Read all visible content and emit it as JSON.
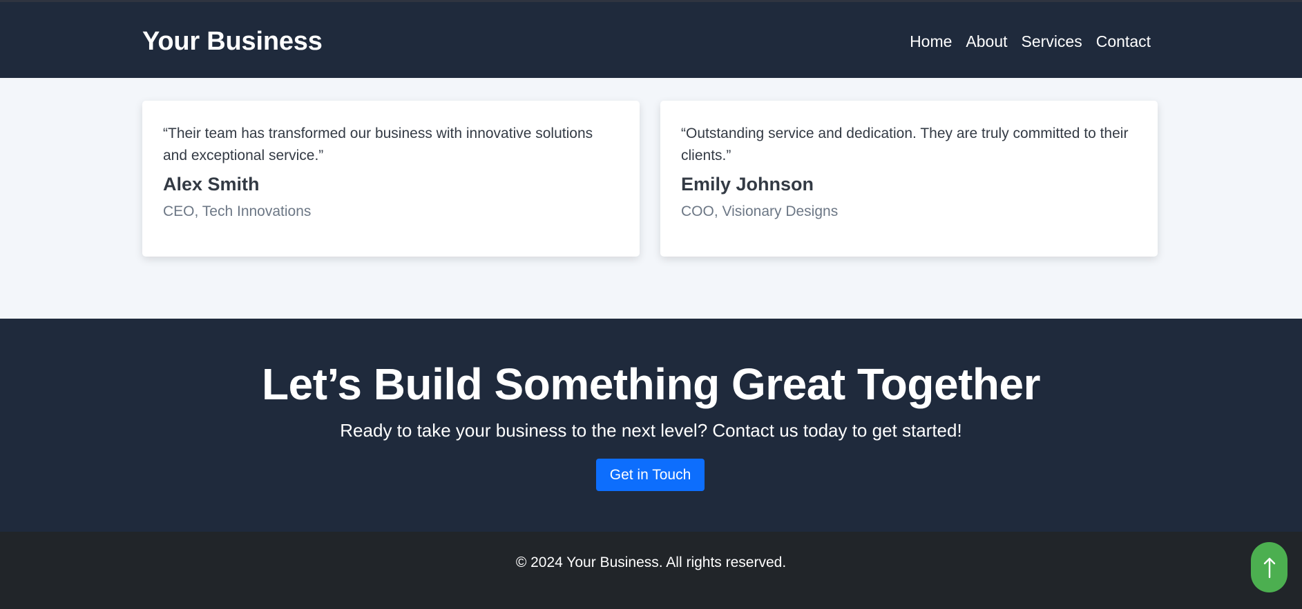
{
  "navbar": {
    "brand": "Your Business",
    "links": [
      {
        "label": "Home"
      },
      {
        "label": "About"
      },
      {
        "label": "Services"
      },
      {
        "label": "Contact"
      }
    ]
  },
  "testimonials": {
    "cards": [
      {
        "quote": "“Their team has transformed our business with innovative solutions and exceptional service.”",
        "name": "Alex Smith",
        "role": "CEO, Tech Innovations"
      },
      {
        "quote": "“Outstanding service and dedication. They are truly committed to their clients.”",
        "name": "Emily Johnson",
        "role": "COO, Visionary Designs"
      }
    ]
  },
  "cta": {
    "title": "Let’s Build Something Great Together",
    "subtitle": "Ready to take your business to the next level? Contact us today to get started!",
    "button_label": "Get in Touch"
  },
  "footer": {
    "copyright": "© 2024 Your Business. All rights reserved."
  },
  "scroll_top": {
    "icon": "arrow-up-icon"
  },
  "colors": {
    "navbar_bg": "#1f2a3c",
    "cta_bg": "#1f2a3c",
    "footer_bg": "#212529",
    "primary": "#0d6efd",
    "scroll_top_bg": "#4caf50",
    "page_bg": "#f3f6fa"
  }
}
